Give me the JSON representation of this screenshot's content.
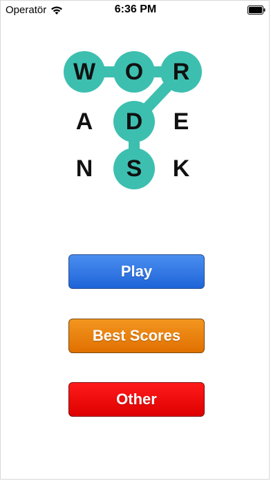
{
  "status_bar": {
    "carrier": "Operatör",
    "time": "6:36 PM",
    "wifi_icon": "wifi-icon",
    "battery_icon": "battery-icon"
  },
  "logo": {
    "highlight_color": "#3dbfb0",
    "letters": [
      [
        "W",
        "O",
        "R"
      ],
      [
        "A",
        "D",
        "E"
      ],
      [
        "N",
        "S",
        "K"
      ]
    ],
    "highlighted": [
      "W",
      "O",
      "R",
      "D",
      "S"
    ]
  },
  "menu": {
    "play_label": "Play",
    "best_scores_label": "Best Scores",
    "other_label": "Other"
  },
  "colors": {
    "play": "#2a73e6",
    "best_scores": "#ea8310",
    "other": "#ee0000"
  }
}
